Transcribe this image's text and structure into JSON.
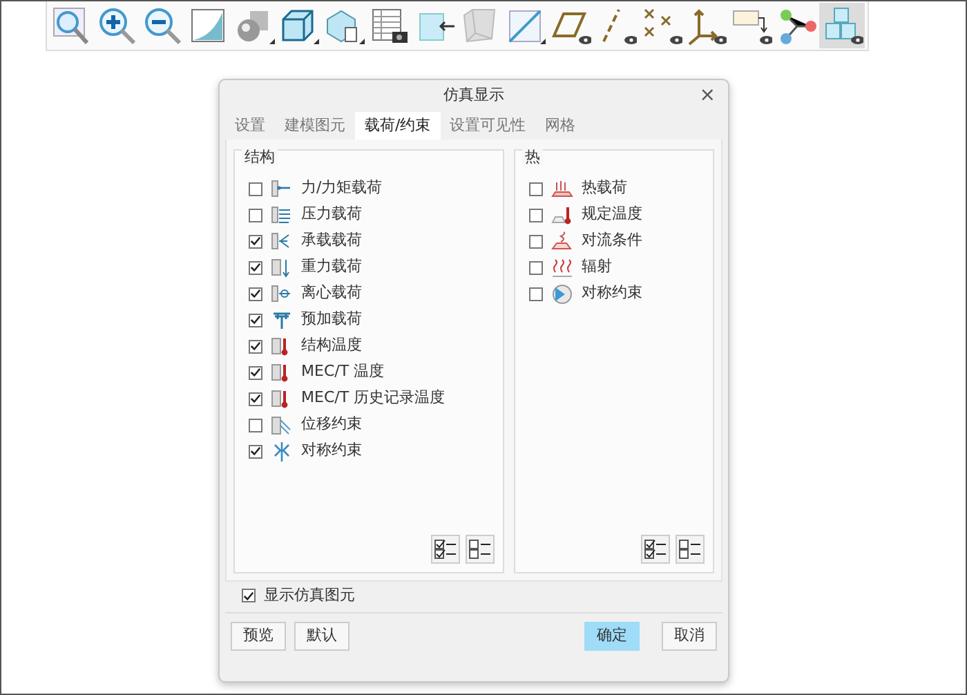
{
  "toolbar": [
    {
      "kind": "magnifier",
      "menu": false,
      "selected": false
    },
    {
      "kind": "zoom-in",
      "menu": false,
      "selected": false
    },
    {
      "kind": "zoom-out",
      "menu": false,
      "selected": false
    },
    {
      "kind": "refit",
      "menu": false,
      "selected": false
    },
    {
      "kind": "shapes",
      "menu": true,
      "selected": false
    },
    {
      "kind": "cube",
      "menu": true,
      "selected": false
    },
    {
      "kind": "cube-doc",
      "menu": true,
      "selected": false
    },
    {
      "kind": "table-camera",
      "menu": false,
      "selected": false
    },
    {
      "kind": "box-arrow",
      "menu": false,
      "selected": false
    },
    {
      "kind": "grey-box",
      "menu": false,
      "selected": false
    },
    {
      "kind": "plane",
      "menu": true,
      "selected": false
    },
    {
      "kind": "parallelogram-eye",
      "menu": false,
      "selected": false
    },
    {
      "kind": "dashline-eye",
      "menu": false,
      "selected": false
    },
    {
      "kind": "crosses-eye",
      "menu": false,
      "selected": false
    },
    {
      "kind": "axes-eye",
      "menu": false,
      "selected": false
    },
    {
      "kind": "note-eye",
      "menu": false,
      "selected": false
    },
    {
      "kind": "branch",
      "menu": false,
      "selected": false
    },
    {
      "kind": "cubes-eye",
      "menu": false,
      "selected": true
    }
  ],
  "dialog": {
    "title": "仿真显示",
    "close": "×",
    "tabs": [
      {
        "label": "设置",
        "selected": false
      },
      {
        "label": "建模图元",
        "selected": false
      },
      {
        "label": "载荷/约束",
        "selected": true
      },
      {
        "label": "设置可见性",
        "selected": false
      },
      {
        "label": "网格",
        "selected": false
      }
    ],
    "groups": [
      {
        "title": "结构",
        "items": [
          {
            "label": "力/力矩载荷",
            "checked": false,
            "kind": "force"
          },
          {
            "label": "压力载荷",
            "checked": false,
            "kind": "pressure"
          },
          {
            "label": "承载载荷",
            "checked": true,
            "kind": "bearing"
          },
          {
            "label": "重力载荷",
            "checked": true,
            "kind": "gravity"
          },
          {
            "label": "离心载荷",
            "checked": true,
            "kind": "centrifugal"
          },
          {
            "label": "预加载荷",
            "checked": true,
            "kind": "preload"
          },
          {
            "label": "结构温度",
            "checked": true,
            "kind": "temperature"
          },
          {
            "label": "MEC/T 温度",
            "checked": true,
            "kind": "temperature"
          },
          {
            "label": "MEC/T 历史记录温度",
            "checked": true,
            "kind": "temperature"
          },
          {
            "label": "位移约束",
            "checked": false,
            "kind": "displacement"
          },
          {
            "label": "对称约束",
            "checked": true,
            "kind": "symmetry"
          }
        ]
      },
      {
        "title": "热",
        "items": [
          {
            "label": "热载荷",
            "checked": false,
            "kind": "heat"
          },
          {
            "label": "规定温度",
            "checked": false,
            "kind": "prescribed"
          },
          {
            "label": "对流条件",
            "checked": false,
            "kind": "convection"
          },
          {
            "label": "辐射",
            "checked": false,
            "kind": "radiation"
          },
          {
            "label": "对称约束",
            "checked": false,
            "kind": "cyclic"
          }
        ]
      }
    ],
    "show_elements": {
      "label": "显示仿真图元",
      "checked": true
    },
    "buttons_left": [
      "预览",
      "默认"
    ],
    "buttons_right": [
      {
        "label": "确定",
        "primary": true
      },
      {
        "label": "取消",
        "primary": false
      }
    ]
  }
}
